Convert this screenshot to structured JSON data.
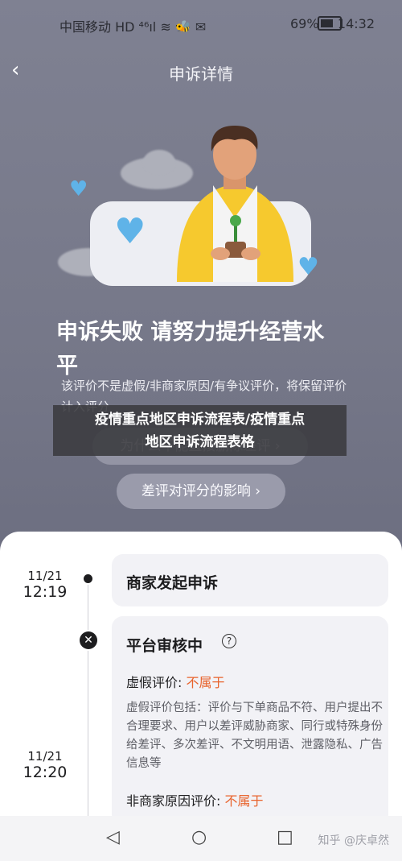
{
  "status_bar": {
    "carrier": "中国移动 HD ⁴⁶ıl ≋ 🐝 ✉",
    "battery": "69%",
    "time": "14:32"
  },
  "nav": {
    "back_icon": "chevron-left-icon",
    "title": "申诉详情"
  },
  "result": {
    "headline": "申诉失败 请努力提升经营水平",
    "description": "该评价不是虚假/非商家原因/有争议评价，将保留评价计入评分",
    "why_button": "为什么不能直接删除差评 ›",
    "impact_button": "差评对评分的影响 ›"
  },
  "banner": {
    "line1": "疫情重点地区申诉流程表/疫情重点",
    "line2": "地区申诉流程表格"
  },
  "timeline": [
    {
      "date": "11/21",
      "time": "12:19",
      "title": "商家发起申诉"
    },
    {
      "date": "11/21",
      "time": "12:20",
      "title": "平台审核中",
      "fake_label": "虚假评价:",
      "fake_value": "不属于",
      "fake_desc": "虚假评价包括：评价与下单商品不符、用户提出不合理要求、用户以差评威胁商家、同行或特殊身份给差评、多次差评、不文明用语、泄露隐私、广告信息等",
      "nonmerchant_label": "非商家原因评价:",
      "nonmerchant_value": "不属于"
    }
  ],
  "watermark": "知乎 @庆卓然",
  "colors": {
    "accent_orange": "#e8632c",
    "heart_blue": "#5fb3e8",
    "shirt_yellow": "#f6c92e"
  }
}
